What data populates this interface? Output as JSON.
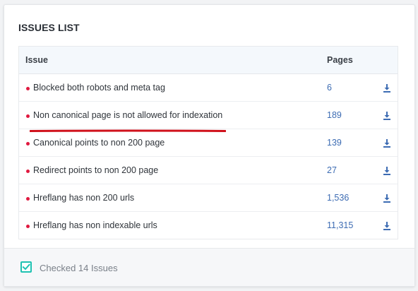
{
  "panel": {
    "title": "ISSUES LIST"
  },
  "table": {
    "headers": {
      "issue": "Issue",
      "pages": "Pages"
    },
    "rows": [
      {
        "issue": "Blocked both robots and meta tag",
        "pages": "6"
      },
      {
        "issue": "Non canonical page is not allowed for indexation",
        "pages": "189"
      },
      {
        "issue": "Canonical points to non 200 page",
        "pages": "139"
      },
      {
        "issue": "Redirect points to non 200 page",
        "pages": "27"
      },
      {
        "issue": "Hreflang has non 200 urls",
        "pages": "1,536"
      },
      {
        "issue": "Hreflang has non indexable urls",
        "pages": "11,315"
      }
    ]
  },
  "footer": {
    "checked_label": "Checked 14 Issues",
    "checked": true
  },
  "colors": {
    "status_dot": "#e0193f",
    "link": "#3d6cb3",
    "download_icon": "#3d6cb3",
    "checkbox": "#1fc2b2",
    "annotation_underline": "#d0111b"
  },
  "icons": {
    "row_status": "red-dot-icon",
    "row_action": "download-icon",
    "footer": "checkbox-check-icon"
  }
}
